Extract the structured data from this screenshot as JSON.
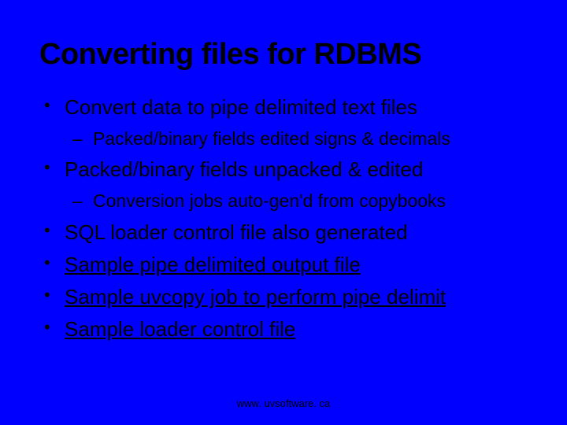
{
  "title": "Converting files for RDBMS",
  "bullets": {
    "b1": "Convert data to pipe delimited text files",
    "b1_sub": "Packed/binary fields edited signs & decimals",
    "b2": "Packed/binary fields unpacked & edited",
    "b2_sub": "Conversion jobs auto-gen'd from copybooks",
    "b3": "SQL loader control file also generated",
    "b4": "Sample pipe delimited output file",
    "b5": "Sample uvcopy job to perform pipe delimit",
    "b6": "Sample loader control file"
  },
  "footer": "www. uvsoftware. ca"
}
